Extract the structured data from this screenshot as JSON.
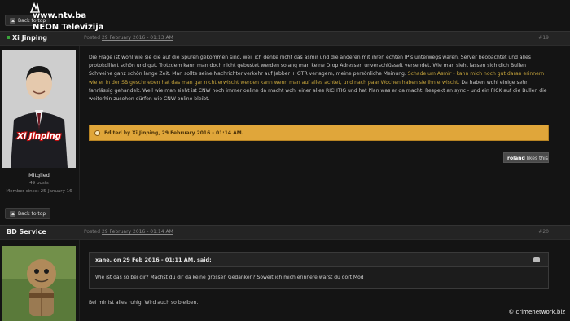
{
  "watermark": {
    "line1": "www.ntv.ba",
    "line2": "NEON Televizija",
    "credit": "© crimenetwork.biz"
  },
  "top_button": {
    "label": "Back to top"
  },
  "post1": {
    "username": "Xi Jinping",
    "posted_prefix": "Posted",
    "posted_date": "29 February 2016 - 01:13 AM",
    "post_number": "#19",
    "avatar_caption": "Xi Jinping",
    "member_title": "Mitglied",
    "posts_count": "49 posts",
    "member_since": "Member since: 25-January 16",
    "text_part1": "Die Frage ist wohl wie sie die auf die Spuren gekommen sind, weil ich denke nicht das asmir und die anderen mit ihren echten IP's unterwegs waren. Server beobachtet und alles protokolliert schön und gut. Trotzdem kann man doch nicht gebustet werden solang man keine Drop Adressen unverschlüsselt versendet. Wie man sieht lassen sich dich Bullen Schweine ganz schön lange Zeit. Man sollte seine Nachrichtenverkehr auf Jabber + OTR verlagern, meine persönliche Meinung.",
    "text_highlight": "Schade um Asmir - kann mich noch gut daran erinnern wie er in der SB geschrieben hat das man gar nicht erwischt werden kann wenn man auf alles achtet, und nach paar Wochen haben sie ihn erwischt.",
    "text_part2": "Da haben wohl einige sehr fahrlässig gehandelt. Weil wie man sieht ist CNW noch immer online da macht wohl einer alles RICHTIG und hat Plan was er da macht. Respekt an sync - und ein FICK auf die Bullen die weiterhin zusehen dürfen wie CNW online bleibt.",
    "edited": "Edited by Xi Jinping, 29 February 2016 - 01:14 AM.",
    "likes_user": "roland",
    "likes_suffix": "likes this",
    "back_to_top": "Back to top"
  },
  "post2": {
    "username": "BD Service",
    "posted_prefix": "Posted",
    "posted_date": "29 February 2016 - 01:14 AM",
    "post_number": "#20",
    "quote_header": "xane, on 29 Feb 2016 - 01:11 AM, said:",
    "quote_text": "Wie ist das so bei dir? Machst du dir da keine grossen Gedanken? Soweit ich mich erinnere warst du dort Mod",
    "reply": "Bei mir ist alles ruhig. Wird auch so bleiben."
  },
  "icons": [
    "back-to-top-icon",
    "online-status-icon",
    "edit-info-icon",
    "quote-bubble-icon",
    "channel-logo-icon"
  ],
  "colors": {
    "edited_bg": "#e0a63a",
    "highlight_text": "#c7a53c",
    "online": "#3aa33a"
  }
}
